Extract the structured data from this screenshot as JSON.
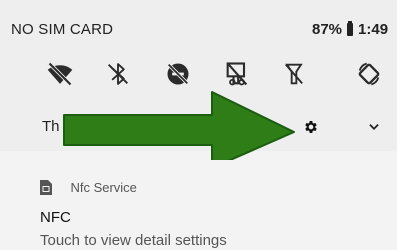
{
  "status_bar": {
    "carrier": "NO SIM CARD",
    "battery_percent": "87%",
    "time": "1:49"
  },
  "quick_settings": {
    "tiles": [
      {
        "icon": "wifi-off-icon",
        "state": "off"
      },
      {
        "icon": "bluetooth-off-icon",
        "state": "off"
      },
      {
        "icon": "do-not-disturb-off-icon",
        "state": "off"
      },
      {
        "icon": "flashlight-off-icon",
        "state": "off"
      },
      {
        "icon": "signal-off-icon",
        "state": "off"
      },
      {
        "icon": "auto-rotate-icon",
        "state": "on"
      }
    ],
    "footer_text": "Th",
    "settings_icon": "gear-icon",
    "expand_icon": "chevron-down-icon"
  },
  "annotation": {
    "arrow_color": "#2e7d17",
    "arrow_outline": "#1b5e10"
  },
  "notification": {
    "app_icon": "sim-card-icon",
    "app_name": "Nfc Service",
    "title": "NFC",
    "text": "Touch to view detail settings"
  },
  "colors": {
    "icon": "#2b2b2b",
    "shade_bg": "#eeeeee",
    "notification_bg": "#f3f3f3"
  }
}
